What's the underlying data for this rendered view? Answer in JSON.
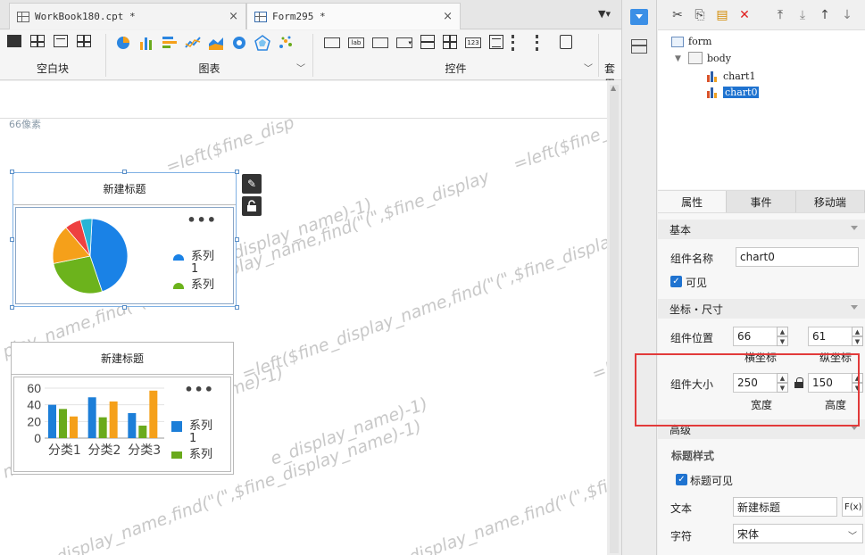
{
  "tabs": [
    {
      "label": "WorkBook180.cpt *",
      "active": false
    },
    {
      "label": "Form295 *",
      "active": true
    }
  ],
  "toolbar": {
    "groups": [
      {
        "label": "空白块"
      },
      {
        "label": "图表"
      },
      {
        "label": "控件"
      },
      {
        "label": "套用"
      }
    ]
  },
  "canvas": {
    "pixel_label": "66像素",
    "watermark_texts": [
      "=left($fine_disp",
      "=left($fine_",
      "fine_display_name)-1)",
      "play_name,find(\"(\",$fine_display_name,find(\"(\",$fine_display",
      "=left($fine_display_name,find(\"(\",$fine_display_n",
      "=left(",
      "e_display_name)-1)",
      "me,find(\"(\",$fine_display_name)-1)",
      "display_name,find(\"(\",$fi",
      "display_name,find(\"(\",$fine_display_name)-1)"
    ],
    "widgets": [
      {
        "title": "新建标题",
        "menu": "•••",
        "legend": [
          "系列",
          "1",
          "系列"
        ]
      },
      {
        "title": "新建标题",
        "menu": "•••",
        "legend": [
          "系列",
          "1",
          "系列"
        ]
      }
    ]
  },
  "chart_data": [
    {
      "type": "pie",
      "values": [
        44,
        27,
        17,
        7,
        5
      ],
      "colors": [
        "#1a82e6",
        "#6cb31c",
        "#f5a01a",
        "#ee4040",
        "#28b4d6"
      ],
      "legend": [
        "系列1",
        "系列"
      ]
    },
    {
      "type": "bar",
      "categories": [
        "分类1",
        "分类2",
        "分类3"
      ],
      "series": [
        {
          "values": [
            40,
            49,
            30
          ],
          "color": "#1c7ed8"
        },
        {
          "values": [
            35,
            25,
            15
          ],
          "color": "#6aaa1c"
        },
        {
          "values": [
            26,
            44,
            57
          ],
          "color": "#f5a01a"
        }
      ],
      "yticks": [
        "60",
        "40",
        "20",
        "0"
      ],
      "ylim": [
        0,
        60
      ],
      "legend": [
        "系列1",
        "系列"
      ]
    }
  ],
  "tree": {
    "form": "form",
    "body": "body",
    "chart1": "chart1",
    "chart0": "chart0"
  },
  "panel": {
    "tabs": [
      "属性",
      "事件",
      "移动端"
    ],
    "section_basic": "基本",
    "name_label": "组件名称",
    "name_value": "chart0",
    "visible_label": "可见",
    "section_coord": "坐标・尺寸",
    "pos_label": "组件位置",
    "pos_x": "66",
    "pos_y": "61",
    "x_label": "横坐标",
    "y_label": "纵坐标",
    "size_label": "组件大小",
    "width": "250",
    "height": "150",
    "width_label": "宽度",
    "height_label": "高度",
    "section_advanced": "高级",
    "title_style": "标题样式",
    "title_visible": "标题可见",
    "text_label": "文本",
    "text_value": "新建标题",
    "fx": "F(x)",
    "font_label": "字符",
    "font_value": "宋体"
  }
}
